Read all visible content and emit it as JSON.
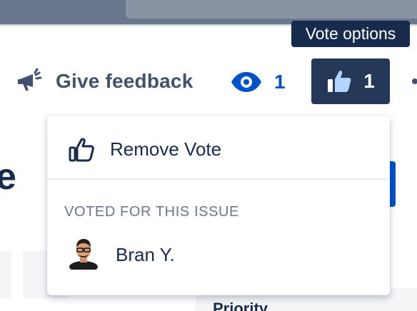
{
  "tooltip": {
    "text": "Vote options"
  },
  "toolbar": {
    "feedback": {
      "label": "Give feedback",
      "icon": "megaphone-icon"
    },
    "watch": {
      "count": "1",
      "icon": "eye-icon"
    },
    "vote": {
      "count": "1",
      "icon": "thumbs-up-icon"
    }
  },
  "dropdown": {
    "remove_vote_label": "Remove Vote",
    "section_title": "VOTED FOR THIS ISSUE",
    "voters": [
      {
        "name": "Bran Y."
      }
    ]
  },
  "background": {
    "heading_fragment": "e",
    "priority_label": "Priority"
  },
  "colors": {
    "navy": "#172b4d",
    "vote_button": "#253858",
    "link_blue": "#0052cc",
    "muted": "#6b778c",
    "icon_light_blue": "#b3d4ff"
  }
}
